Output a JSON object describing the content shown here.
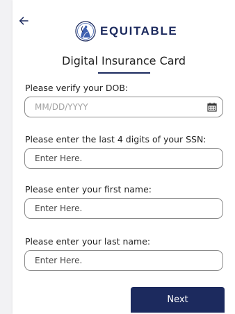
{
  "header": {
    "back_icon": "arrow-left-icon",
    "brand_name": "EQUITABLE",
    "brand_logo_icon": "equitable-statue-logo-icon",
    "brand_color": "#1c2a5e"
  },
  "page": {
    "title": "Digital Insurance Card"
  },
  "form": {
    "dob": {
      "label": "Please verify your DOB:",
      "placeholder": "MM/DD/YYYY",
      "value": "",
      "icon": "calendar-icon"
    },
    "ssn": {
      "label": "Please enter the last 4 digits of your SSN:",
      "placeholder": "Enter Here.",
      "value": ""
    },
    "first_name": {
      "label": "Please enter your first name:",
      "placeholder": "Enter Here.",
      "value": ""
    },
    "last_name": {
      "label": "Please enter your last name:",
      "placeholder": "Enter Here.",
      "value": ""
    },
    "next_label": "Next"
  }
}
